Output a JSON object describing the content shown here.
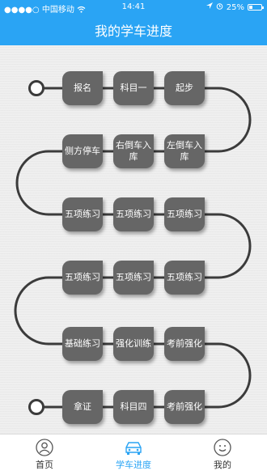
{
  "status_bar": {
    "carrier": "中国移动",
    "time": "14:41",
    "battery": "25%",
    "battery_level": 0.25,
    "wifi_icon": "wifi-icon",
    "alarm_icon": "alarm-icon"
  },
  "header": {
    "title": "我的学车进度"
  },
  "progress": {
    "steps": [
      {
        "label": "报名"
      },
      {
        "label": "科目一"
      },
      {
        "label": "起步"
      },
      {
        "label": "侧方停车"
      },
      {
        "label": "右倒车入库"
      },
      {
        "label": "左倒车入库"
      },
      {
        "label": "五项练习"
      },
      {
        "label": "五项练习"
      },
      {
        "label": "五项练习"
      },
      {
        "label": "五项练习"
      },
      {
        "label": "五项练习"
      },
      {
        "label": "五项练习"
      },
      {
        "label": "基础练习"
      },
      {
        "label": "强化训练"
      },
      {
        "label": "考前强化"
      },
      {
        "label": "拿证"
      },
      {
        "label": "科目四"
      },
      {
        "label": "考前强化"
      }
    ]
  },
  "tabbar": {
    "active_color": "#2aa4f4",
    "items": [
      {
        "label": "首页",
        "icon": "home-icon"
      },
      {
        "label": "学车进度",
        "icon": "car-icon"
      },
      {
        "label": "我的",
        "icon": "user-icon"
      }
    ]
  }
}
